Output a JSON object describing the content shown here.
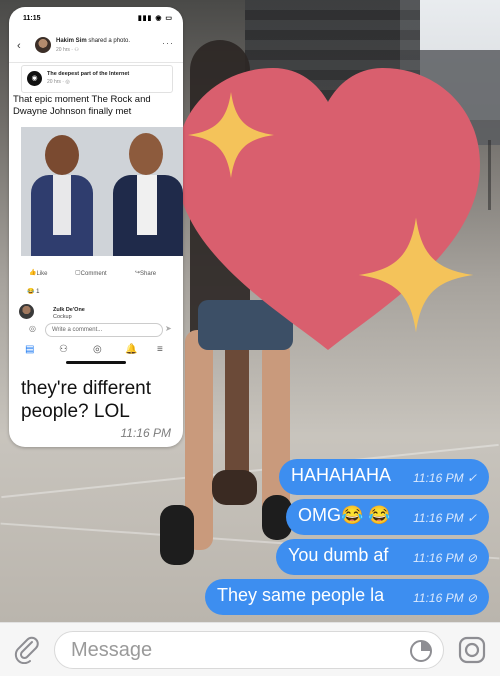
{
  "fb_post": {
    "status_time": "11:15",
    "status_icons": "▮▮▮ ◉ ▭",
    "author": "Hakim Sim",
    "action": "shared a photo.",
    "meta": "20 hrs · ⚇",
    "more": "···",
    "page_name": "The deepest part of the Internet",
    "page_meta": "20 hrs · ◎",
    "caption": "That epic moment The Rock and Dwayne Johnson finally met",
    "like_label": "Like",
    "comment_label": "Comment",
    "share_label": "Share",
    "reactions": "😂 1",
    "commenter": "Zulk De'One",
    "comment_text": "Cockup",
    "write_placeholder": "Write a comment..."
  },
  "incoming": {
    "text": "they're different people? LOL",
    "time": "11:16 PM"
  },
  "outgoing": [
    {
      "text": "HAHAHAHA",
      "time": "11:16 PM",
      "status": "✓"
    },
    {
      "text": "OMG😂 😂",
      "time": "11:16 PM",
      "status": "✓"
    },
    {
      "text": "You dumb af",
      "time": "11:16 PM",
      "status": "⊘"
    },
    {
      "text": "They same people la",
      "time": "11:16 PM",
      "status": "⊘"
    }
  ],
  "composer": {
    "placeholder": "Message"
  },
  "icons": [
    "back-icon",
    "attach-icon",
    "sticker-icon",
    "camera-icon",
    "heart-sticker",
    "sparkle-icon"
  ],
  "colors": {
    "bubble_blue": "#3d8ef0",
    "heart_pink": "#d95f6e",
    "sparkle_yellow": "#f4c35a"
  }
}
